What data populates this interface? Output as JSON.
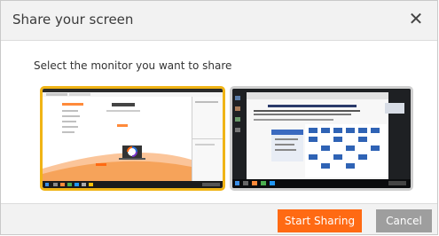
{
  "dialog": {
    "title": "Share your screen",
    "close_glyph": "✕",
    "prompt": "Select the monitor you want to share"
  },
  "monitors": [
    {
      "name": "monitor-1",
      "selected": true,
      "border_color": "#f0b416"
    },
    {
      "name": "monitor-2",
      "selected": false,
      "border_color": "#cfcfcf"
    }
  ],
  "buttons": {
    "start_label": "Start Sharing",
    "cancel_label": "Cancel"
  },
  "colors": {
    "accent": "#ff6a13",
    "selected_border": "#f0b416",
    "cancel": "#9e9e9e"
  }
}
